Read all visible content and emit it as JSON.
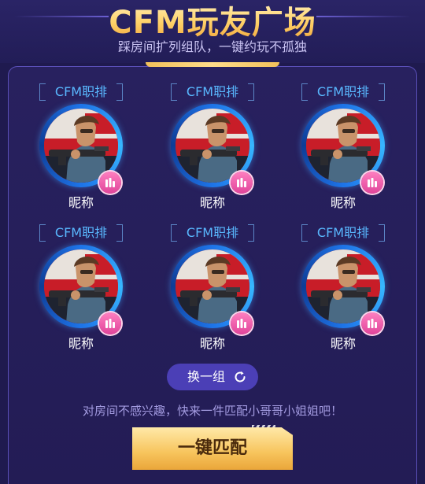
{
  "header": {
    "title": "CFM玩友广场",
    "subtitle": "踩房间扩列组队，一键约玩不孤独"
  },
  "players": [
    {
      "tag": "CFM职排",
      "nickname": "昵称"
    },
    {
      "tag": "CFM职排",
      "nickname": "昵称"
    },
    {
      "tag": "CFM职排",
      "nickname": "昵称"
    },
    {
      "tag": "CFM职排",
      "nickname": "昵称"
    },
    {
      "tag": "CFM职排",
      "nickname": "昵称"
    },
    {
      "tag": "CFM职排",
      "nickname": "昵称"
    }
  ],
  "actions": {
    "refresh_label": "换一组",
    "hint": "对房间不感兴趣，快来一件匹配小哥哥小姐姐吧！",
    "match_label": "一键匹配"
  },
  "icons": {
    "badge": "audio-bars-icon",
    "refresh": "refresh-icon"
  },
  "colors": {
    "background": "#1f1a4f",
    "tag_text": "#59b8ff",
    "accent_gold": "#f7c45c",
    "badge_pink": "#e0449a"
  }
}
